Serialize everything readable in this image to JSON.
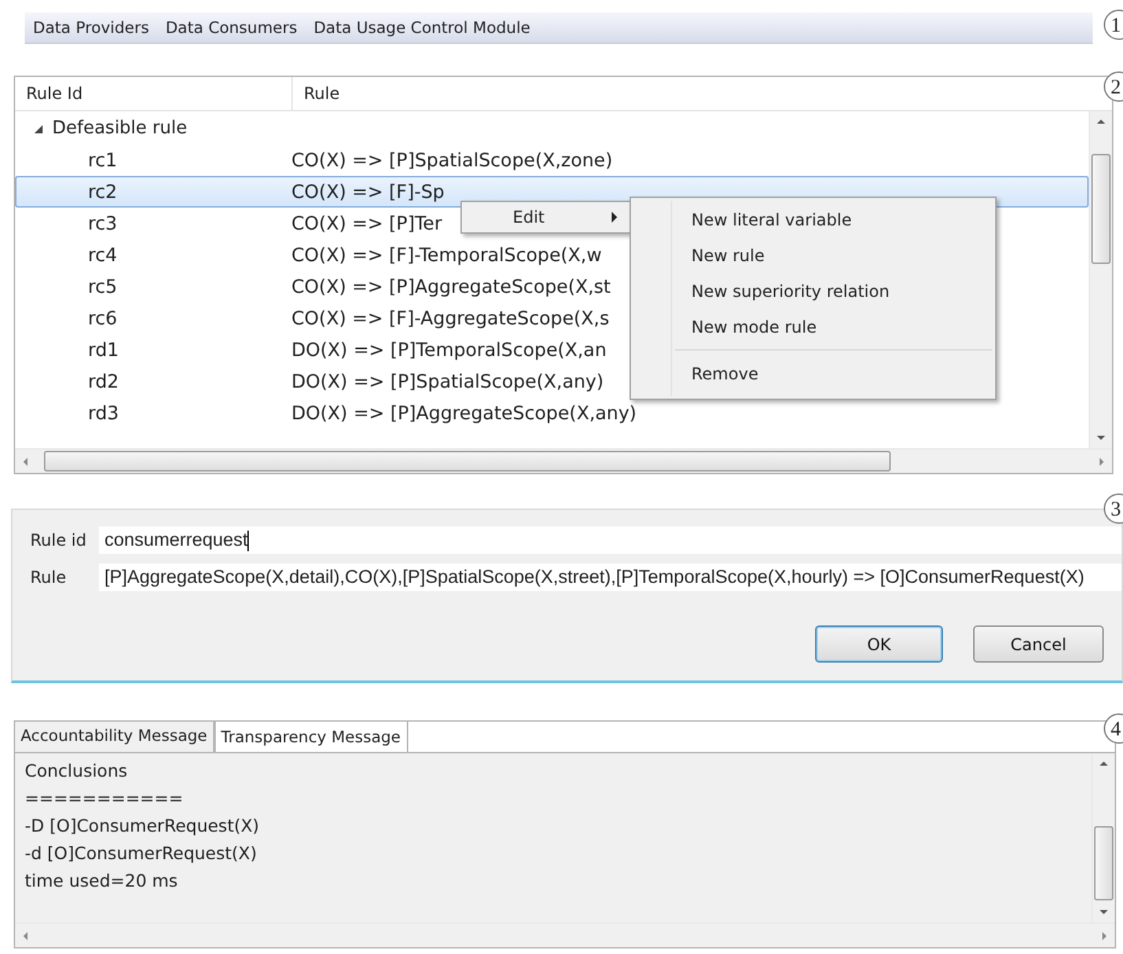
{
  "menu_bar": {
    "marker": "1",
    "items": [
      "Data Providers",
      "Data Consumers",
      "Data Usage Control Module"
    ]
  },
  "rule_table": {
    "marker": "2",
    "columns": [
      "Rule Id",
      "Rule"
    ],
    "groups": [
      {
        "label": "Defeasible rule",
        "expanded": true,
        "children": [
          {
            "id": "rc1",
            "rule": "CO(X) => [P]SpatialScope(X,zone)",
            "selected": false
          },
          {
            "id": "rc2",
            "rule": "CO(X) => [F]-Sp",
            "selected": true
          },
          {
            "id": "rc3",
            "rule": "CO(X) => [P]Ter",
            "selected": false
          },
          {
            "id": "rc4",
            "rule": "CO(X) => [F]-TemporalScope(X,w",
            "selected": false
          },
          {
            "id": "rc5",
            "rule": "CO(X) => [P]AggregateScope(X,st",
            "selected": false
          },
          {
            "id": "rc6",
            "rule": "CO(X) => [F]-AggregateScope(X,s",
            "selected": false
          },
          {
            "id": "rd1",
            "rule": "DO(X) => [P]TemporalScope(X,an",
            "selected": false
          },
          {
            "id": "rd2",
            "rule": "DO(X) => [P]SpatialScope(X,any)",
            "selected": false
          },
          {
            "id": "rd3",
            "rule": "DO(X) => [P]AggregateScope(X,any)",
            "selected": false
          }
        ]
      }
    ]
  },
  "context_menu": {
    "label": "Edit",
    "submenu": [
      {
        "label": "New literal variable",
        "separator_before": false
      },
      {
        "label": "New rule",
        "separator_before": false
      },
      {
        "label": "New superiority relation",
        "separator_before": false
      },
      {
        "label": "New mode rule",
        "separator_before": false
      },
      {
        "label": "Remove",
        "separator_before": true
      }
    ]
  },
  "rule_editor": {
    "marker": "3",
    "fields": [
      {
        "label": "Rule id",
        "value": "consumerrequest",
        "focused": true
      },
      {
        "label": "Rule",
        "value": "[P]AggregateScope(X,detail),CO(X),[P]SpatialScope(X,street),[P]TemporalScope(X,hourly) => [O]ConsumerRequest(X)",
        "focused": false
      }
    ],
    "buttons": [
      {
        "label": "OK",
        "default": true
      },
      {
        "label": "Cancel",
        "default": false
      }
    ]
  },
  "message_panel": {
    "marker": "4",
    "tabs": [
      {
        "label": "Accountability Message",
        "selected": false
      },
      {
        "label": "Transparency Message",
        "selected": true
      }
    ],
    "lines": [
      "Conclusions",
      "===========",
      "-D [O]ConsumerRequest(X)",
      "-d [O]ConsumerRequest(X)",
      "time used=20 ms"
    ]
  }
}
